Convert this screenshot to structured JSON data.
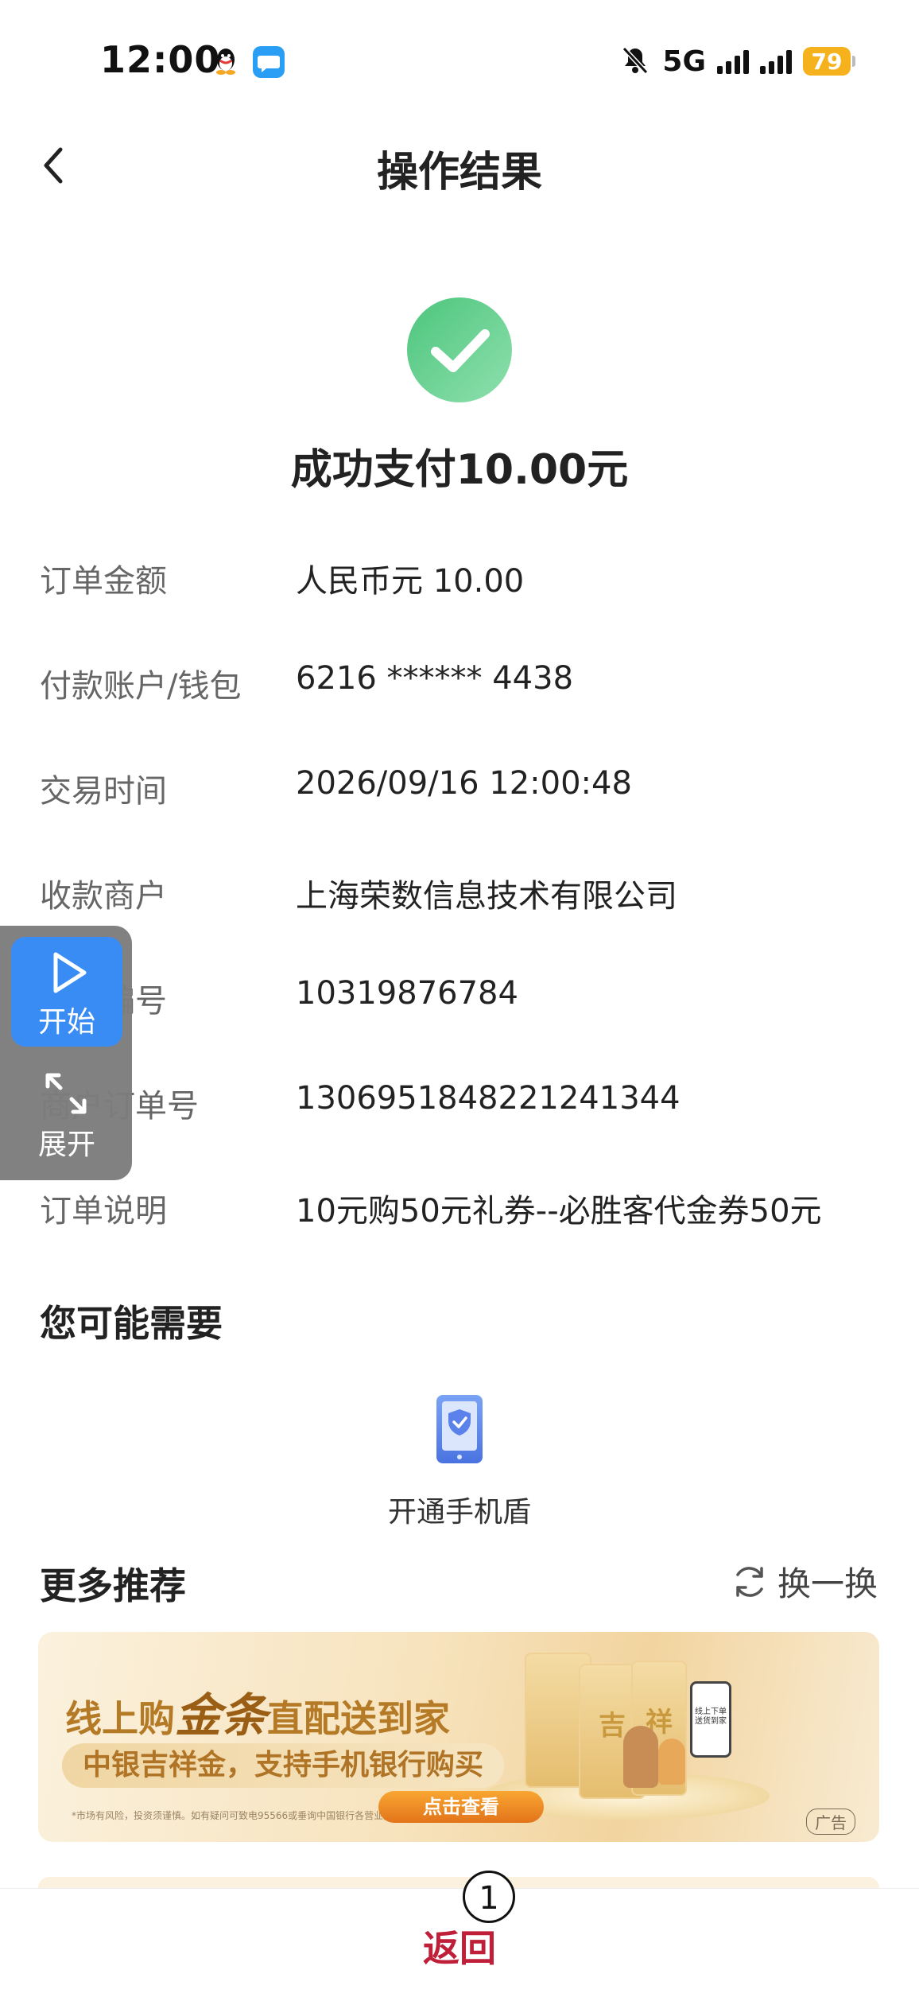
{
  "status_bar": {
    "time": "12:00",
    "network": "5G",
    "battery": "79",
    "icons": [
      "qq-icon",
      "message-icon",
      "mute-icon",
      "signal-icon",
      "battery-icon"
    ]
  },
  "header": {
    "title": "操作结果"
  },
  "result": {
    "message": "成功支付10.00元",
    "icon": "success-check-icon",
    "color": "#5fcf8c"
  },
  "details": [
    {
      "label": "订单金额",
      "value": "人民币元 10.00"
    },
    {
      "label": "付款账户/钱包",
      "value": "6216 ****** 4438"
    },
    {
      "label": "交易时间",
      "value": "2026/09/16 12:00:48"
    },
    {
      "label": "收款商户",
      "value": "上海荣数信息技术有限公司"
    },
    {
      "label": "商户编号",
      "value": "10319876784"
    },
    {
      "label": "商户订单号",
      "value": "1306951848221241344"
    },
    {
      "label": "订单说明",
      "value": "10元购50元礼券--必胜客代金券50元"
    }
  ],
  "needs": {
    "title": "您可能需要",
    "item_label": "开通手机盾",
    "item_icon": "phone-shield-icon"
  },
  "recommend": {
    "title": "更多推荐",
    "refresh_label": "换一换",
    "refresh_icon": "refresh-icon"
  },
  "banner": {
    "line1_a": "线上购",
    "line1_b": "金条",
    "line1_c": "直配送到家",
    "line2": "中银吉祥金，支持手机银行购买",
    "disclaimer": "*市场有风险，投资须谨慎。如有疑问可致电95566或垂询中国银行各营业网点。",
    "cta": "点击查看",
    "ad_tag": "广告",
    "gold_bars": [
      "",
      "吉",
      "祥"
    ],
    "phone_text": "线上下单 送货到家"
  },
  "floating_widget": {
    "start_label": "开始",
    "expand_label": "展开",
    "start_color": "#3a8cf5"
  },
  "bottom": {
    "return_label": "返回",
    "badge": "1",
    "accent": "#c01f3a"
  }
}
